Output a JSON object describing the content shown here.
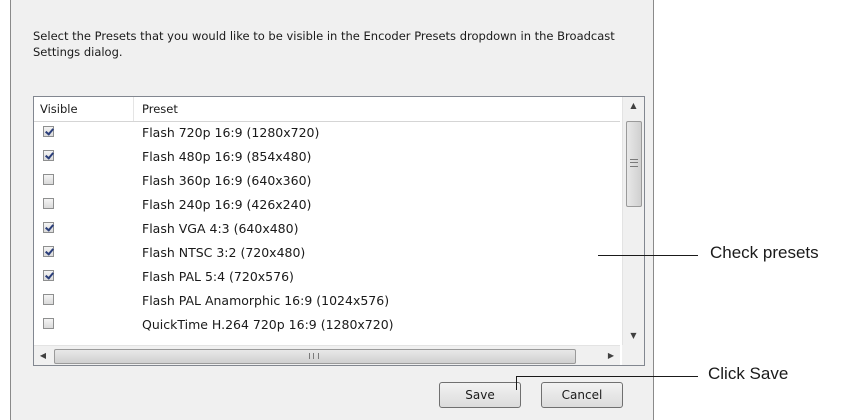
{
  "dialog": {
    "instructions": "Select the Presets that you would like to be visible in the Encoder Presets dropdown in the Broadcast Settings dialog.",
    "columns": {
      "visible": "Visible",
      "preset": "Preset"
    },
    "presets": [
      {
        "name": "Flash 720p 16:9 (1280x720)",
        "visible": true
      },
      {
        "name": "Flash 480p 16:9 (854x480)",
        "visible": true
      },
      {
        "name": "Flash 360p 16:9 (640x360)",
        "visible": false
      },
      {
        "name": "Flash 240p 16:9 (426x240)",
        "visible": false
      },
      {
        "name": "Flash VGA 4:3 (640x480)",
        "visible": true
      },
      {
        "name": "Flash NTSC 3:2 (720x480)",
        "visible": true
      },
      {
        "name": "Flash PAL 5:4 (720x576)",
        "visible": true
      },
      {
        "name": "Flash PAL Anamorphic 16:9 (1024x576)",
        "visible": false
      },
      {
        "name": "QuickTime H.264 720p 16:9 (1280x720)",
        "visible": false
      }
    ],
    "scroll_glyphs": {
      "up": "▲",
      "down": "▼",
      "left": "◀",
      "right": "▶"
    },
    "save_label": "Save",
    "cancel_label": "Cancel"
  },
  "annotations": {
    "check_presets": "Check presets",
    "click_save": "Click Save"
  }
}
